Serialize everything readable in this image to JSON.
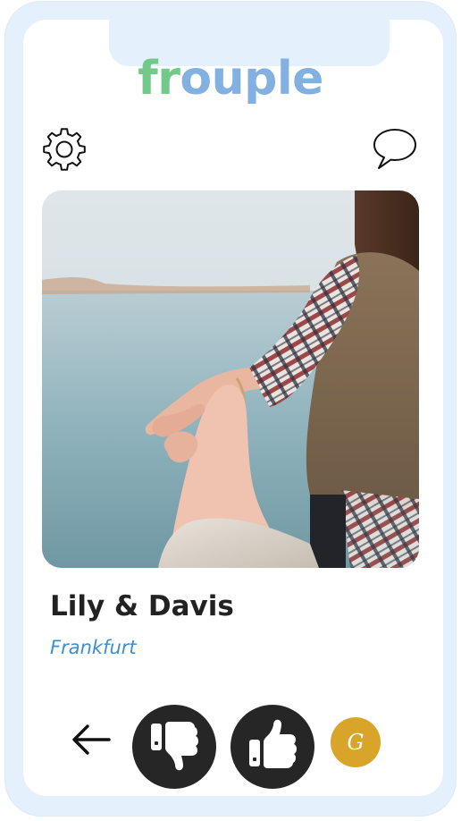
{
  "app": {
    "logo_part1": "fr",
    "logo_part2": "ouple"
  },
  "header": {
    "settings_icon": "gear-icon",
    "chat_icon": "speech-bubble-icon"
  },
  "profile": {
    "names": "Lily & Davis",
    "city": "Frankfurt",
    "photo_description_icon": "couple-holding-hands-photo"
  },
  "actions": {
    "back_icon": "arrow-left-icon",
    "dislike_icon": "thumbs-down-icon",
    "like_icon": "thumbs-up-icon",
    "avatar_initial": "G"
  },
  "colors": {
    "logo_green": "#72c98a",
    "logo_blue": "#82b0e0",
    "city_blue": "#3b8fd4",
    "action_dark": "#262626",
    "avatar_gold": "#d8a52a",
    "frame": "#e4f0fb"
  }
}
